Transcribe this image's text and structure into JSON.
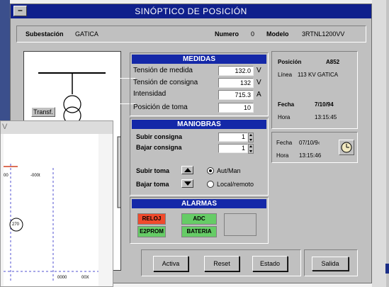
{
  "window": {
    "title": "SINÓPTICO DE POSICIÓN",
    "menu_glyph": "–"
  },
  "header": {
    "subestacion_label": "Subestación",
    "subestacion_value": "GATICA",
    "numero_label": "Numero",
    "numero_value": "0",
    "modelo_label": "Modelo",
    "modelo_value": "3RTNL1200VV"
  },
  "diagram": {
    "transf_label": "Transf."
  },
  "medidas": {
    "header": "MEDIDAS",
    "rows": [
      {
        "label": "Tensión de medida",
        "value": "132.0",
        "unit": "V"
      },
      {
        "label": "Tensión de consigna",
        "value": "132",
        "unit": "V"
      },
      {
        "label": "Intensidad",
        "value": "715.3",
        "unit": "A"
      },
      {
        "label": "Posición de toma",
        "value": "10",
        "unit": ""
      }
    ]
  },
  "posicion": {
    "posicion_label": "Posición",
    "posicion_value": "A852",
    "linea_label": "Línea",
    "linea_value": "113 KV GATICA",
    "fecha_label": "Fecha",
    "fecha_value": "7/10/94",
    "hora_label": "Hora",
    "hora_value": "13:15:45"
  },
  "maniobras": {
    "header": "MANIOBRAS",
    "subir_consigna_label": "Subir consigna",
    "subir_consigna_value": "1",
    "bajar_consigna_label": "Bajar consigna",
    "bajar_consigna_value": "1",
    "subir_toma_label": "Subir toma",
    "bajar_toma_label": "Bajar toma",
    "radio_aut": "Aut/Man",
    "radio_local": "Local/remoto"
  },
  "reloj": {
    "fecha_label": "Fecha",
    "fecha_value": "07/10/9‹",
    "hora_label": "Hora",
    "hora_value": "13:15:46"
  },
  "alarmas": {
    "header": "ALARMAS",
    "items": [
      {
        "label": "RELOJ",
        "color": "#f04a2c"
      },
      {
        "label": "ADC",
        "color": "#66cc66"
      },
      {
        "label": "E2PROM",
        "color": "#66cc66"
      },
      {
        "label": "BATERIA",
        "color": "#66cc66"
      }
    ]
  },
  "buttons": {
    "activa": "Activa",
    "reset": "Reset",
    "estado": "Estado",
    "salida": "Salida"
  },
  "child_window": {
    "title_fragment": "V",
    "labels": {
      "a": "00",
      "b": "-000t",
      "node": "270",
      "c": "0000",
      "d": "00X"
    }
  },
  "colors": {
    "title_bar": "#10208c",
    "section_header": "#1428a8",
    "alarm_red": "#f04a2c",
    "alarm_green": "#66cc66"
  }
}
